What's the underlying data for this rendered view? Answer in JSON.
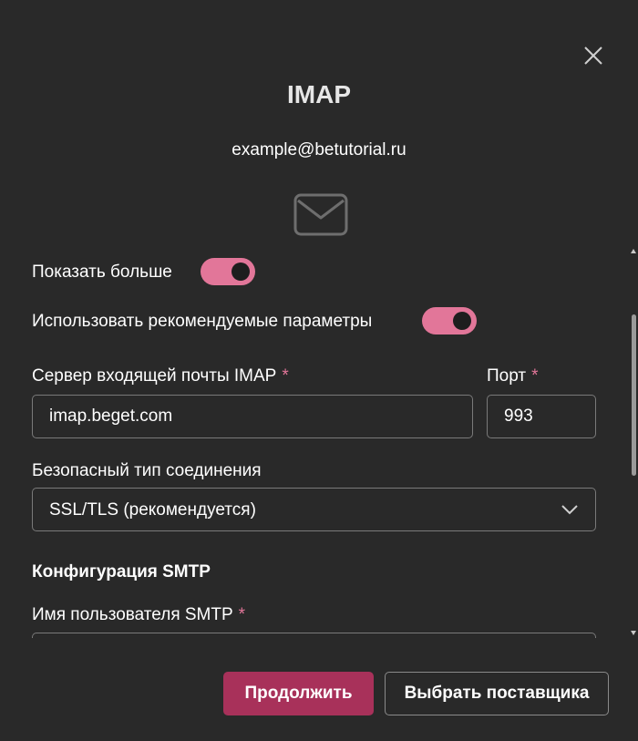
{
  "dialog": {
    "title": "IMAP",
    "email": "example@betutorial.ru"
  },
  "toggles": {
    "show_more": {
      "label": "Показать больше",
      "on": true
    },
    "use_recommended": {
      "label": "Использовать рекомендуемые параметры",
      "on": true
    }
  },
  "imap": {
    "server_label": "Сервер входящей почты IMAP",
    "server_value": "imap.beget.com",
    "port_label": "Порт",
    "port_value": "993",
    "required_mark": "*"
  },
  "security": {
    "label": "Безопасный тип соединения",
    "selected": "SSL/TLS (рекомендуется)"
  },
  "smtp": {
    "section_title": "Конфигурация SMTP",
    "username_label": "Имя пользователя SMTP"
  },
  "buttons": {
    "continue": "Продолжить",
    "choose_provider": "Выбрать поставщика"
  },
  "colors": {
    "background": "#292929",
    "accent": "#e27699",
    "primary_button": "#a8315a",
    "border": "#7a7a7a"
  },
  "icons": [
    "close-icon",
    "mail-icon",
    "chevron-down-icon",
    "scroll-up-icon",
    "scroll-down-icon"
  ]
}
